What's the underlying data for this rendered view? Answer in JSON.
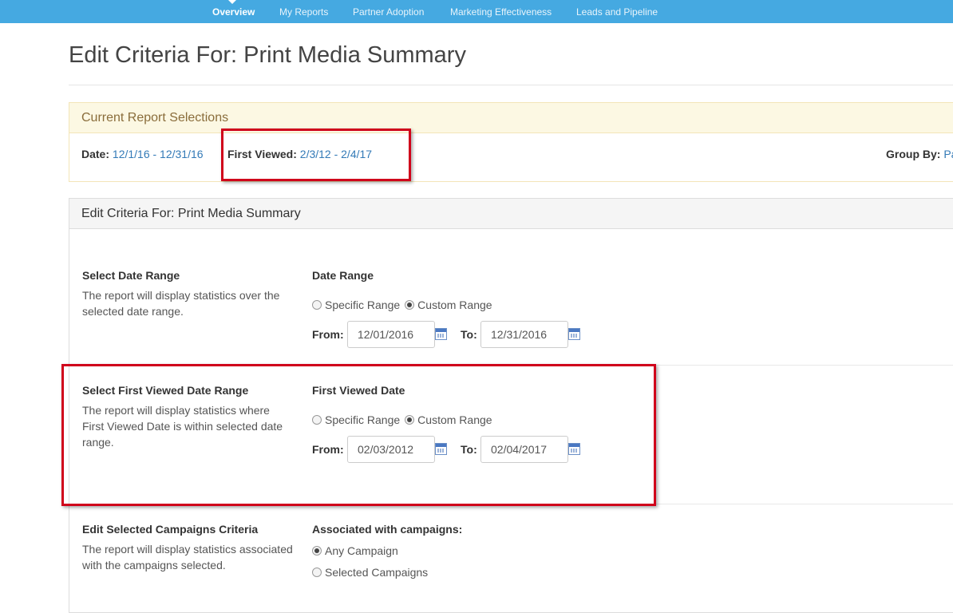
{
  "nav": {
    "items": [
      {
        "label": "Overview",
        "active": true
      },
      {
        "label": "My Reports",
        "active": false
      },
      {
        "label": "Partner Adoption",
        "active": false
      },
      {
        "label": "Marketing Effectiveness",
        "active": false
      },
      {
        "label": "Leads and Pipeline",
        "active": false
      }
    ]
  },
  "page": {
    "title": "Edit Criteria For: Print Media Summary"
  },
  "selections": {
    "heading": "Current Report Selections",
    "date": {
      "label": "Date:",
      "value": "12/1/16 - 12/31/16"
    },
    "first_viewed": {
      "label": "First Viewed:",
      "value": "2/3/12 - 2/4/17"
    },
    "group_by": {
      "label": "Group By:",
      "value": "Pa"
    }
  },
  "criteria": {
    "heading": "Edit Criteria For: Print Media Summary",
    "date_range": {
      "title": "Select Date Range",
      "description": "The report will display statistics over the selected date range.",
      "field_title": "Date Range",
      "option_specific": "Specific Range",
      "option_custom": "Custom Range",
      "selected": "custom",
      "from_label": "From:",
      "from_value": "12/01/2016",
      "to_label": "To:",
      "to_value": "12/31/2016"
    },
    "first_viewed": {
      "title": "Select First Viewed Date Range",
      "description": "The report will display statistics where First Viewed Date is within selected date range.",
      "field_title": "First Viewed Date",
      "option_specific": "Specific Range",
      "option_custom": "Custom Range",
      "selected": "custom",
      "from_label": "From:",
      "from_value": "02/03/2012",
      "to_label": "To:",
      "to_value": "02/04/2017"
    },
    "campaigns": {
      "title": "Edit Selected Campaigns Criteria",
      "description": "The report will display statistics associated with the campaigns selected.",
      "field_title": "Associated with campaigns:",
      "option_any": "Any Campaign",
      "option_selected": "Selected Campaigns",
      "selected": "any"
    }
  },
  "colors": {
    "nav_bg": "#45a9e1",
    "link": "#337ab7",
    "highlight": "#d0021b"
  }
}
